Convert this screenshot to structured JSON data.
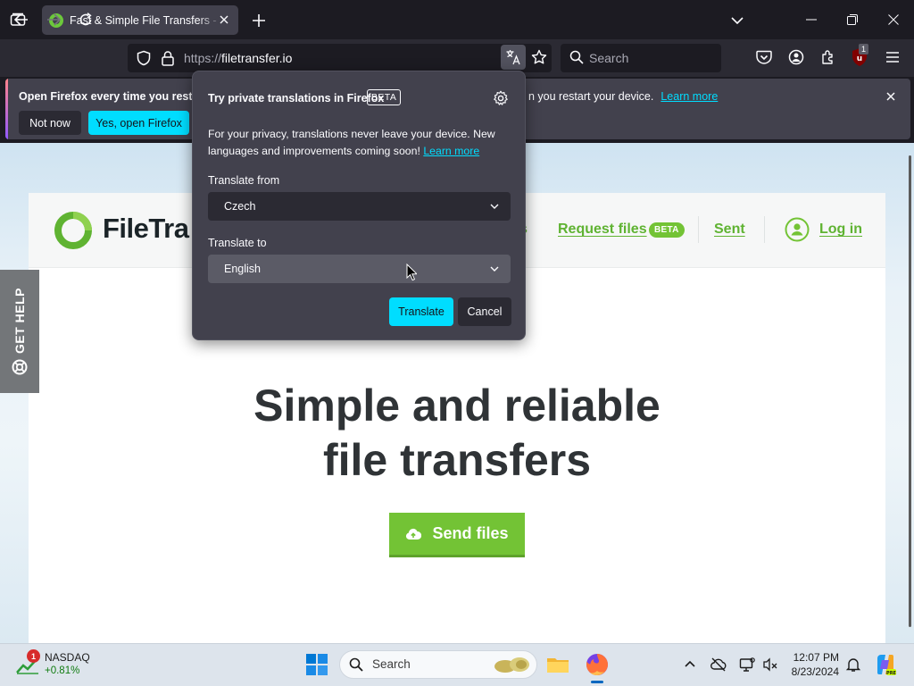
{
  "browser": {
    "tab": {
      "title": "Fast & Simple File Transfers - FileTransfer.io",
      "favicon": "filetransfer-favicon"
    },
    "url": {
      "protocol": "https://",
      "host": "filetransfer.io"
    },
    "search_placeholder": "Search",
    "extension_badge": "1",
    "icons": [
      "tab-list-icon",
      "close-icon",
      "plus-icon",
      "chevron-down-icon",
      "minimize-icon",
      "restore-icon",
      "window-close-icon",
      "back-arrow-icon",
      "forward-arrow-icon",
      "reload-icon",
      "shield-icon",
      "lock-icon",
      "translate-icon",
      "star-icon",
      "search-icon",
      "pocket-icon",
      "account-icon",
      "extensions-icon",
      "ublock-icon",
      "hamburger-menu-icon"
    ]
  },
  "notification": {
    "title": "Open Firefox every time you restart your device",
    "title_visible": "Open Firefox every time you restar",
    "trailing_text": "n you restart your device.",
    "learn_more": "Learn more",
    "not_now": "Not now",
    "yes_open": "Yes, open Firefox"
  },
  "translation_panel": {
    "title": "Try private translations in Firefox",
    "beta": "BETA",
    "description": "For your privacy, translations never leave your device. New languages and improvements coming soon!",
    "learn_more": "Learn more",
    "from_label": "Translate from",
    "from_value": "Czech",
    "to_label": "Translate to",
    "to_value": "English",
    "translate_button": "Translate",
    "cancel_button": "Cancel"
  },
  "site": {
    "logo_text": "FileTra",
    "nav": {
      "partial": "s",
      "request_files": "Request files",
      "beta": "BETA",
      "sent": "Sent",
      "log_in": "Log in"
    },
    "hero_line1": "Simple and reliable",
    "hero_line2": "file transfers",
    "send_files": "Send files",
    "get_help": "GET HELP"
  },
  "taskbar": {
    "stock": {
      "name": "NASDAQ",
      "change": "+0.81%",
      "badge": "1"
    },
    "search_placeholder": "Search",
    "time": "12:07 PM",
    "date": "8/23/2024"
  },
  "colors": {
    "brand_green": "#73c335",
    "firefox_accent": "#00ddff",
    "panel_bg": "#42414d"
  }
}
